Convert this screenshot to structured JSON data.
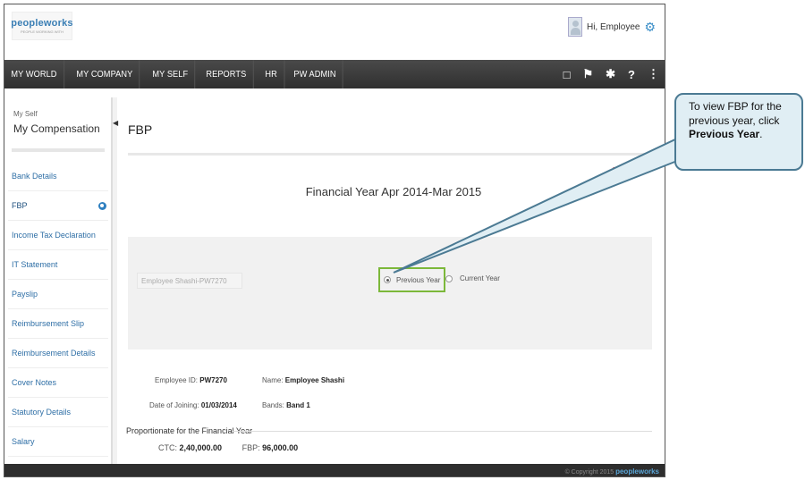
{
  "header": {
    "logo_text": "peopleworks",
    "logo_sub": "PEOPLE WORKING WITH",
    "greeting": "Hi, Employee"
  },
  "nav": {
    "items": [
      "MY WORLD",
      "MY COMPANY",
      "MY SELF",
      "REPORTS",
      "HR",
      "PW ADMIN"
    ],
    "icons": [
      "book-icon",
      "flag-icon",
      "tools-icon",
      "help-icon",
      "share-icon"
    ]
  },
  "sidebar": {
    "section": "My Self",
    "title": "My Compensation",
    "items": [
      {
        "label": "Bank Details"
      },
      {
        "label": "FBP"
      },
      {
        "label": "Income Tax Declaration"
      },
      {
        "label": "IT Statement"
      },
      {
        "label": "Payslip"
      },
      {
        "label": "Reimbursement Slip"
      },
      {
        "label": "Reimbursement Details"
      },
      {
        "label": "Cover Notes"
      },
      {
        "label": "Statutory Details"
      },
      {
        "label": "Salary"
      }
    ]
  },
  "main": {
    "title": "FBP",
    "financial_year": "Financial Year Apr 2014-Mar 2015",
    "employee_field": "Employee Shashi-PW7270",
    "radio_previous": "Previous Year",
    "radio_current": "Current Year",
    "employee_id_label": "Employee ID:",
    "employee_id": "PW7270",
    "name_label": "Name:",
    "name": "Employee Shashi",
    "doj_label": "Date of Joining:",
    "doj": "01/03/2014",
    "bands_label": "Bands:",
    "bands": "Band 1",
    "proportionate_title": "Proportionate for the Financial Year",
    "ctc_label": "CTC:",
    "ctc": "2,40,000.00",
    "fbp_label": "FBP:",
    "fbp": "96,000.00"
  },
  "footer": {
    "copyright": "© Copyright 2015",
    "brand": "peopleworks"
  },
  "callout": {
    "text_1": "To view FBP for the previous year, click ",
    "bold": "Previous Year",
    "text_2": "."
  },
  "colors": {
    "nav_bg": "#3a3a3a",
    "link": "#2f6fa6",
    "highlight": "#7cb83a",
    "callout_bg": "#e0eef4",
    "callout_border": "#4b7a93"
  }
}
